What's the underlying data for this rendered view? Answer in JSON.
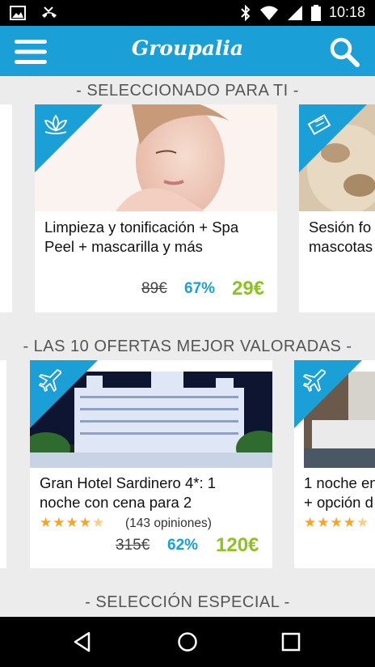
{
  "status_bar": {
    "time": "10:18"
  },
  "app_bar": {
    "logo": "Groupalia"
  },
  "sections": {
    "featured": "- SELECCIONADO PARA TI -",
    "top_rated": "- LAS 10 OFERTAS MEJOR VALORADAS -",
    "special": "- SELECCIÓN ESPECIAL -"
  },
  "featured_cards": [
    {
      "badge_icon": "lotus-icon",
      "title_line1": "Limpieza y tonificación + Spa",
      "title_line2": "Peel + mascarilla y más",
      "old_price": "89€",
      "discount": "67%",
      "price": "29€"
    },
    {
      "badge_icon": "ticket-icon",
      "title_line1": "Sesión fo",
      "title_line2": "mascotas"
    }
  ],
  "top_rated_cards": [
    {
      "badge_icon": "plane-icon",
      "title_line1": "Gran Hotel Sardinero 4*: 1",
      "title_line2": "noche con cena para 2",
      "rating": 4.5,
      "reviews": "(143 opiniones)",
      "old_price": "315€",
      "discount": "62%",
      "price": "120€"
    },
    {
      "badge_icon": "plane-icon",
      "title_line1": "1 noche en",
      "title_line2": "+ opción d",
      "rating": 4.5
    }
  ],
  "colors": {
    "brand_blue": "#1a9fd7",
    "price_green": "#8dc21f",
    "star_orange": "#f5a623"
  }
}
